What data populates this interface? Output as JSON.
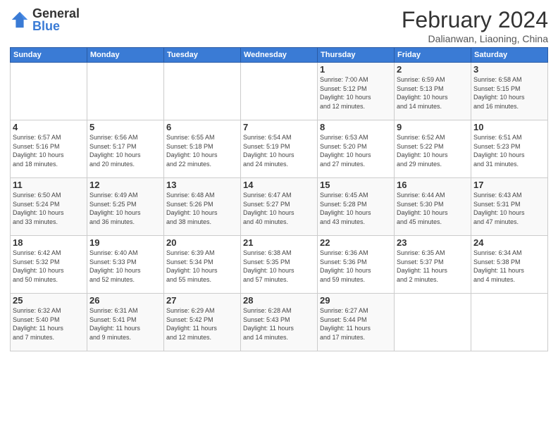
{
  "logo": {
    "general": "General",
    "blue": "Blue"
  },
  "header": {
    "month": "February 2024",
    "location": "Dalianwan, Liaoning, China"
  },
  "weekdays": [
    "Sunday",
    "Monday",
    "Tuesday",
    "Wednesday",
    "Thursday",
    "Friday",
    "Saturday"
  ],
  "weeks": [
    [
      {
        "day": "",
        "info": ""
      },
      {
        "day": "",
        "info": ""
      },
      {
        "day": "",
        "info": ""
      },
      {
        "day": "",
        "info": ""
      },
      {
        "day": "1",
        "info": "Sunrise: 7:00 AM\nSunset: 5:12 PM\nDaylight: 10 hours\nand 12 minutes."
      },
      {
        "day": "2",
        "info": "Sunrise: 6:59 AM\nSunset: 5:13 PM\nDaylight: 10 hours\nand 14 minutes."
      },
      {
        "day": "3",
        "info": "Sunrise: 6:58 AM\nSunset: 5:15 PM\nDaylight: 10 hours\nand 16 minutes."
      }
    ],
    [
      {
        "day": "4",
        "info": "Sunrise: 6:57 AM\nSunset: 5:16 PM\nDaylight: 10 hours\nand 18 minutes."
      },
      {
        "day": "5",
        "info": "Sunrise: 6:56 AM\nSunset: 5:17 PM\nDaylight: 10 hours\nand 20 minutes."
      },
      {
        "day": "6",
        "info": "Sunrise: 6:55 AM\nSunset: 5:18 PM\nDaylight: 10 hours\nand 22 minutes."
      },
      {
        "day": "7",
        "info": "Sunrise: 6:54 AM\nSunset: 5:19 PM\nDaylight: 10 hours\nand 24 minutes."
      },
      {
        "day": "8",
        "info": "Sunrise: 6:53 AM\nSunset: 5:20 PM\nDaylight: 10 hours\nand 27 minutes."
      },
      {
        "day": "9",
        "info": "Sunrise: 6:52 AM\nSunset: 5:22 PM\nDaylight: 10 hours\nand 29 minutes."
      },
      {
        "day": "10",
        "info": "Sunrise: 6:51 AM\nSunset: 5:23 PM\nDaylight: 10 hours\nand 31 minutes."
      }
    ],
    [
      {
        "day": "11",
        "info": "Sunrise: 6:50 AM\nSunset: 5:24 PM\nDaylight: 10 hours\nand 33 minutes."
      },
      {
        "day": "12",
        "info": "Sunrise: 6:49 AM\nSunset: 5:25 PM\nDaylight: 10 hours\nand 36 minutes."
      },
      {
        "day": "13",
        "info": "Sunrise: 6:48 AM\nSunset: 5:26 PM\nDaylight: 10 hours\nand 38 minutes."
      },
      {
        "day": "14",
        "info": "Sunrise: 6:47 AM\nSunset: 5:27 PM\nDaylight: 10 hours\nand 40 minutes."
      },
      {
        "day": "15",
        "info": "Sunrise: 6:45 AM\nSunset: 5:28 PM\nDaylight: 10 hours\nand 43 minutes."
      },
      {
        "day": "16",
        "info": "Sunrise: 6:44 AM\nSunset: 5:30 PM\nDaylight: 10 hours\nand 45 minutes."
      },
      {
        "day": "17",
        "info": "Sunrise: 6:43 AM\nSunset: 5:31 PM\nDaylight: 10 hours\nand 47 minutes."
      }
    ],
    [
      {
        "day": "18",
        "info": "Sunrise: 6:42 AM\nSunset: 5:32 PM\nDaylight: 10 hours\nand 50 minutes."
      },
      {
        "day": "19",
        "info": "Sunrise: 6:40 AM\nSunset: 5:33 PM\nDaylight: 10 hours\nand 52 minutes."
      },
      {
        "day": "20",
        "info": "Sunrise: 6:39 AM\nSunset: 5:34 PM\nDaylight: 10 hours\nand 55 minutes."
      },
      {
        "day": "21",
        "info": "Sunrise: 6:38 AM\nSunset: 5:35 PM\nDaylight: 10 hours\nand 57 minutes."
      },
      {
        "day": "22",
        "info": "Sunrise: 6:36 AM\nSunset: 5:36 PM\nDaylight: 10 hours\nand 59 minutes."
      },
      {
        "day": "23",
        "info": "Sunrise: 6:35 AM\nSunset: 5:37 PM\nDaylight: 11 hours\nand 2 minutes."
      },
      {
        "day": "24",
        "info": "Sunrise: 6:34 AM\nSunset: 5:38 PM\nDaylight: 11 hours\nand 4 minutes."
      }
    ],
    [
      {
        "day": "25",
        "info": "Sunrise: 6:32 AM\nSunset: 5:40 PM\nDaylight: 11 hours\nand 7 minutes."
      },
      {
        "day": "26",
        "info": "Sunrise: 6:31 AM\nSunset: 5:41 PM\nDaylight: 11 hours\nand 9 minutes."
      },
      {
        "day": "27",
        "info": "Sunrise: 6:29 AM\nSunset: 5:42 PM\nDaylight: 11 hours\nand 12 minutes."
      },
      {
        "day": "28",
        "info": "Sunrise: 6:28 AM\nSunset: 5:43 PM\nDaylight: 11 hours\nand 14 minutes."
      },
      {
        "day": "29",
        "info": "Sunrise: 6:27 AM\nSunset: 5:44 PM\nDaylight: 11 hours\nand 17 minutes."
      },
      {
        "day": "",
        "info": ""
      },
      {
        "day": "",
        "info": ""
      }
    ]
  ]
}
